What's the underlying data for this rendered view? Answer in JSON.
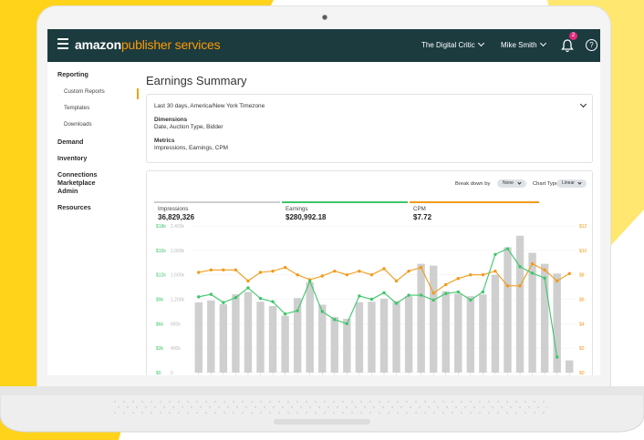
{
  "colors": {
    "yellow": "#ffd31a",
    "yellow_light": "#ffe770",
    "topbar": "#1c3b3f",
    "brand_accent": "#ff9900",
    "impressions": "#cfcfcf",
    "earnings": "#3fc56b",
    "cpm": "#f29a1a",
    "badge": "#e02a7b"
  },
  "header": {
    "brand_bold": "amazon",
    "brand_rest": "publisher services",
    "menu_icon": "hamburger-menu-icon",
    "site_select": "The Digital Critic",
    "user_select": "Mike Smith",
    "notification_count": "2",
    "notification_icon": "bell-icon",
    "help_icon": "?"
  },
  "sidebar": {
    "reporting": "Reporting",
    "custom_reports": "Custom Reports",
    "templates": "Templates",
    "downloads": "Downloads",
    "demand": "Demand",
    "inventory": "Inventory",
    "connections": "Connections Marketplace",
    "admin": "Admin",
    "resources": "Resources"
  },
  "page_title": "Earnings Summary",
  "filters": {
    "range": "Last 30 days,  America/New York Timezone",
    "dimensions_label": "Dimensions",
    "dimensions_value": "Date, Auction Type, Bidder",
    "metrics_label": "Metrics",
    "metrics_value": "Impressions, Earnings, CPM"
  },
  "controls": {
    "break_down_label": "Break down by",
    "break_down_value": "None",
    "chart_type_label": "Chart Type",
    "chart_type_value": "Linear"
  },
  "metrics": [
    {
      "label": "Impressions",
      "value": "36,829,326"
    },
    {
      "label": "Earnings",
      "value": "$280,992.18"
    },
    {
      "label": "CPM",
      "value": "$7.72"
    }
  ],
  "chart_data": {
    "type": "bar+line",
    "left_axis_earnings": [
      "$18k",
      "$15k",
      "$12k",
      "$9k",
      "$6k",
      "$3k",
      "$0"
    ],
    "left_axis_impressions": [
      "2,400k",
      "2,000k",
      "1,600k",
      "1,200k",
      "800k",
      "400k",
      "0"
    ],
    "right_axis_cpm": [
      "$12",
      "$10",
      "$8",
      "$6",
      "$4",
      "$2",
      "$0"
    ],
    "series": [
      {
        "name": "Impressions",
        "type": "bar",
        "axis": "impressions_k",
        "values": [
          1150,
          1180,
          1120,
          1280,
          1320,
          1160,
          1090,
          930,
          1220,
          1480,
          1110,
          910,
          880,
          1150,
          1160,
          1210,
          1170,
          1250,
          1780,
          1750,
          1330,
          1290,
          1250,
          1280,
          1600,
          2050,
          2240,
          1960,
          1780,
          1620,
          200
        ]
      },
      {
        "name": "Earnings",
        "type": "line",
        "axis": "earnings_usd",
        "values": [
          9300,
          9600,
          8600,
          9200,
          10400,
          9100,
          8700,
          7200,
          7600,
          11200,
          7500,
          6500,
          6000,
          9400,
          9000,
          9800,
          8500,
          9500,
          9500,
          8900,
          9700,
          9900,
          8900,
          9900,
          14500,
          15200,
          13000,
          12200,
          11600,
          1900
        ]
      },
      {
        "name": "CPM",
        "type": "line",
        "axis": "cpm_usd",
        "values": [
          8.2,
          8.4,
          8.4,
          8.4,
          7.5,
          8.2,
          8.3,
          8.6,
          8.0,
          7.6,
          7.9,
          8.3,
          8.0,
          8.3,
          8.0,
          8.5,
          7.5,
          8.3,
          8.6,
          6.5,
          7.2,
          7.7,
          8.0,
          8.0,
          8.3,
          7.1,
          7.1,
          8.9,
          8.4,
          7.5,
          8.1
        ]
      }
    ]
  }
}
